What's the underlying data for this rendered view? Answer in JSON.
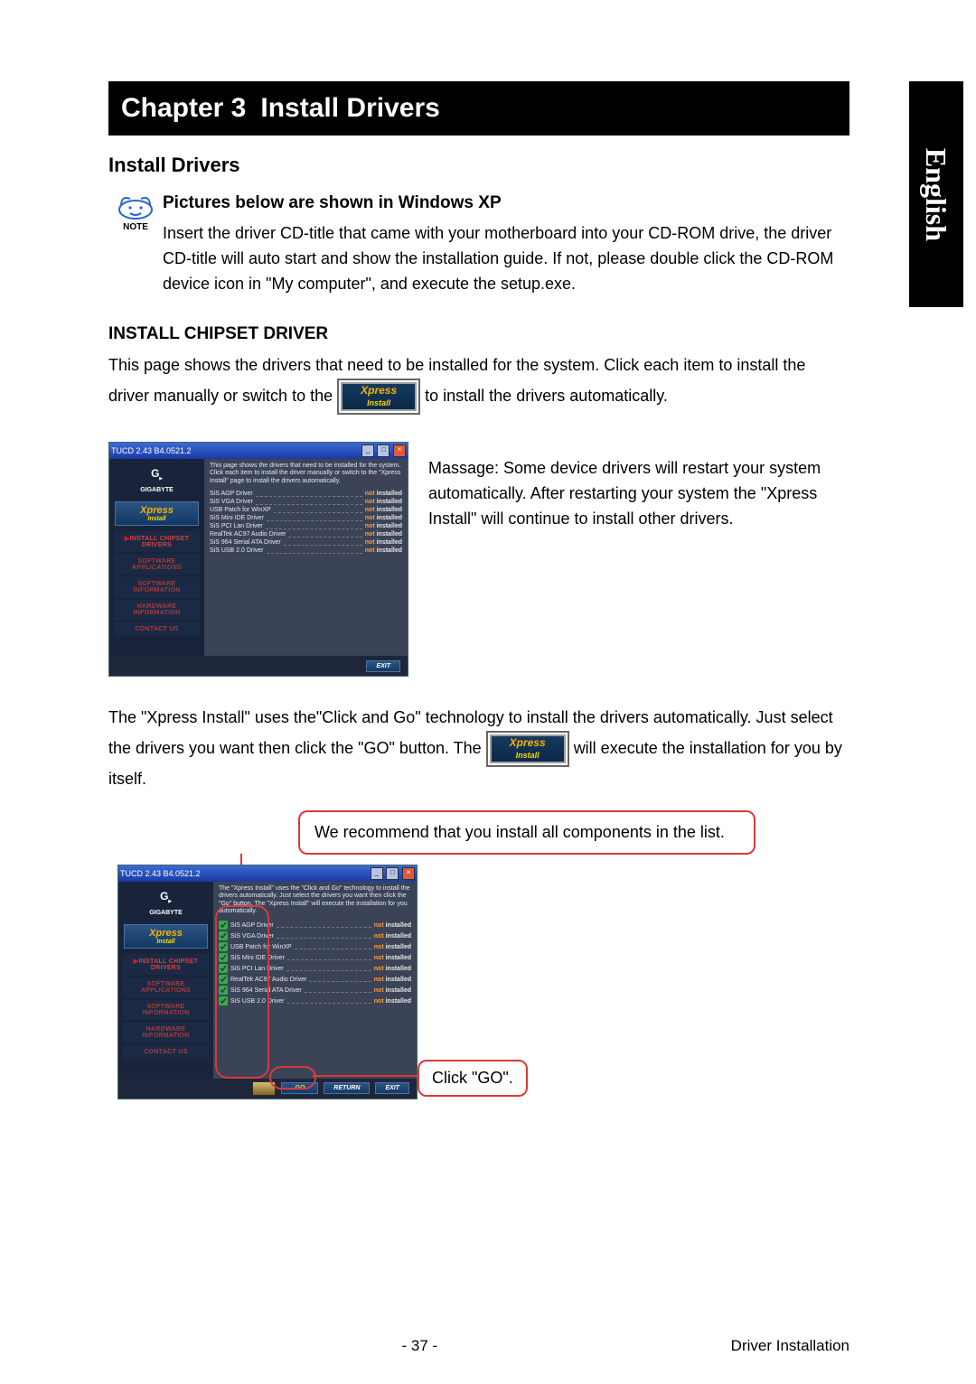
{
  "sideTab": "English",
  "chapterBanner": {
    "chapter": "Chapter 3",
    "title": "Install Drivers"
  },
  "sectionTitle": "Install Drivers",
  "noteLabel": "NOTE",
  "subTitle": "Pictures below are shown in Windows XP",
  "introPara": "Insert the driver CD-title that came with your motherboard into your CD-ROM drive, the driver CD-title will auto start and show the installation guide. If not, please double click the CD-ROM device icon in \"My computer\", and execute the setup.exe.",
  "chipsetHeading": "INSTALL CHIPSET DRIVER",
  "chipsetPara1a": "This page shows the drivers that need to be installed for the system. Click each item  to install the driver manually or switch to the",
  "chipsetPara1b": "to install the drivers automatically.",
  "xpressBadge": {
    "top": "Xpress",
    "bottom": "Install"
  },
  "sidePara": "Massage: Some device drivers will restart your system automatically. After restarting your system the \"Xpress Install\" will continue to install other drivers.",
  "lowerPara1a": "The \"Xpress Install\" uses the\"Click and Go\" technology to install the drivers automatically. Just select the drivers you want then click the \"GO\" button. The",
  "lowerPara1b": "will execute the installation for you by itself.",
  "recommendBox": "We recommend that you install all components in the list.",
  "clickGo": "Click \"GO\".",
  "installer": {
    "title": "TUCD 2.43 B4.0521.2",
    "brand": "GIGABYTE",
    "nav": {
      "xpress": {
        "top": "Xpress",
        "bottom": "Install"
      },
      "install_chipset": "INSTALL CHIPSET DRIVERS",
      "software_applications": "SOFTWARE APPLICATIONS",
      "software_information": "SOFTWARE INFORMATION",
      "hardware_information": "HARDWARE INFORMATION",
      "contact_us": "CONTACT US"
    },
    "centerNote1": "This page shows the drivers that need to be installed for the system. Click each item to install the driver manually or switch to the \"Xpress Install\" page to install the drivers automatically.",
    "centerNote2": "The \"Xpress Install\" uses the \"Click and Go\" technology to install the drivers automatically. Just select the drivers you want then click the \"Go\" button. The \"Xpress Install\" will execute the installation for you automatically.",
    "drivers": [
      {
        "name": "SiS AGP Driver",
        "status": "not installed"
      },
      {
        "name": "SiS VGA Driver",
        "status": "not installed"
      },
      {
        "name": "USB Patch for WinXP",
        "status": "not installed"
      },
      {
        "name": "SiS Mini IDE Driver",
        "status": "not installed"
      },
      {
        "name": "SiS PCI Lan Driver",
        "status": "not installed"
      },
      {
        "name": "RealTek AC97 Audio Driver",
        "status": "not installed"
      },
      {
        "name": "SiS 964 Serial ATA Driver",
        "status": "not installed"
      },
      {
        "name": "SiS USB 2.0 Driver",
        "status": "not installed"
      }
    ],
    "footerButtons": {
      "go": "GO",
      "return": "RETURN",
      "exit": "EXIT"
    }
  },
  "footer": {
    "page": "- 37 -",
    "section": "Driver Installation"
  }
}
